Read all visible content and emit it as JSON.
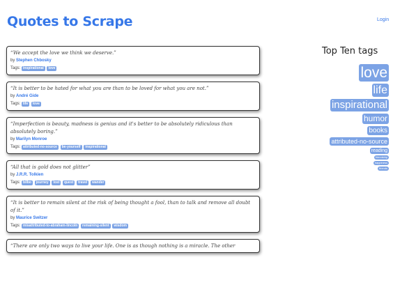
{
  "header": {
    "title": "Quotes to Scrape",
    "login": "Login"
  },
  "quotes": [
    {
      "text": "“We accept the love we think we deserve.”",
      "by": "by",
      "author": "Stephen Chbosky",
      "tags_label": "Tags:",
      "tags": [
        "inspirational",
        "love"
      ]
    },
    {
      "text": "“It is better to be hated for what you are than to be loved for what you are not.”",
      "by": "by",
      "author": "André Gide",
      "tags_label": "Tags:",
      "tags": [
        "life",
        "love"
      ]
    },
    {
      "text": "“Imperfection is beauty, madness is genius and it's better to be absolutely ridiculous than absolutely boring.”",
      "by": "by",
      "author": "Marilyn Monroe",
      "tags_label": "Tags:",
      "tags": [
        "attributed-no-source",
        "be-yourself",
        "inspirational"
      ]
    },
    {
      "text": "“All that is gold does not glitter”",
      "by": "by",
      "author": "J.R.R. Tolkien",
      "tags_label": "Tags:",
      "tags": [
        "bilbo",
        "journey",
        "lost",
        "quest",
        "travel",
        "wander"
      ]
    },
    {
      "text": "“It is better to remain silent at the risk of being thought a fool, than to talk and remove all doubt of it.”",
      "by": "by",
      "author": "Maurice Switzer",
      "tags_label": "Tags:",
      "tags": [
        "misattributed-to-abraham-lincoln",
        "remaining-silent",
        "wisdom"
      ]
    },
    {
      "text": "“There are only two ways to live your life. One is as though nothing is a miracle. The other",
      "by": "",
      "author": "",
      "tags_label": "",
      "tags": []
    }
  ],
  "sidebar": {
    "title": "Top Ten tags",
    "tags": [
      "love",
      "life",
      "inspirational",
      "humor",
      "books",
      "attributed-no-source",
      "reading",
      "friendship",
      "happiness",
      "friends"
    ]
  },
  "colors": {
    "accent": "#3677e8",
    "tag_bg": "#7ca3e5"
  }
}
